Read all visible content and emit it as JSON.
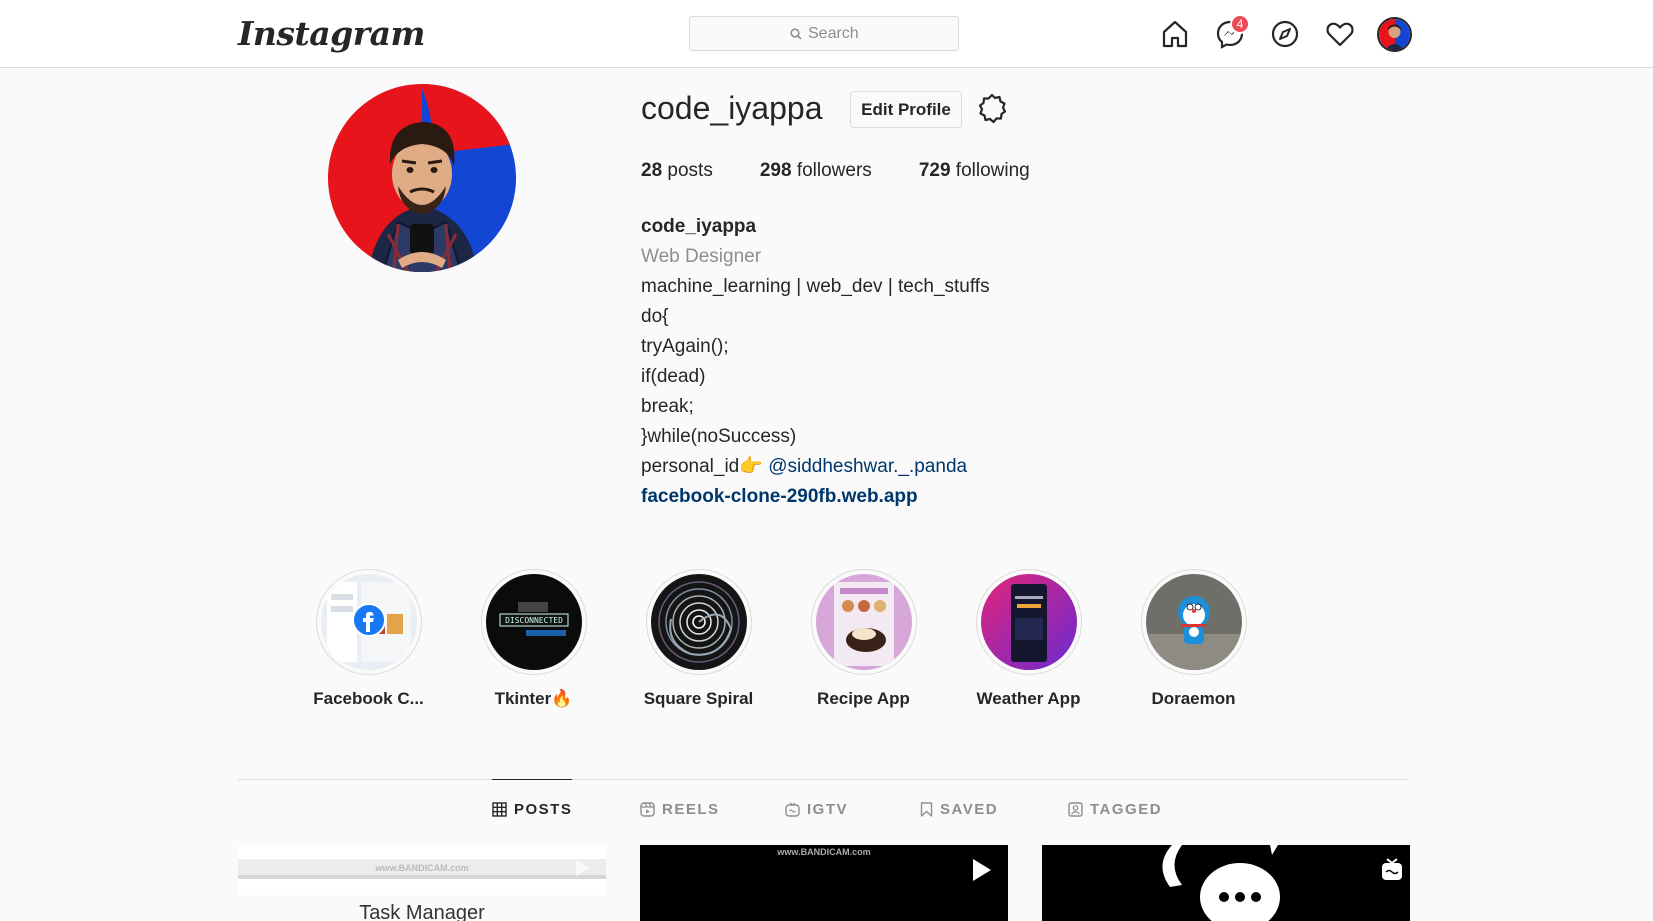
{
  "header": {
    "logo_text": "Instagram",
    "search_placeholder": "Search",
    "messages_badge": "4"
  },
  "profile": {
    "username": "code_iyappa",
    "edit_label": "Edit Profile",
    "stats": {
      "posts_count": "28",
      "posts_label": "posts",
      "followers_count": "298",
      "followers_label": "followers",
      "following_count": "729",
      "following_label": "following"
    },
    "bio": {
      "name": "code_iyappa",
      "category": "Web Designer",
      "lines": [
        "machine_learning | web_dev | tech_stuffs",
        "do{",
        "tryAgain();",
        "if(dead)",
        "break;",
        "}while(noSuccess)"
      ],
      "personal_prefix": "personal_id",
      "personal_emoji": "👉",
      "mention": "@siddheshwar._.panda",
      "website": "facebook-clone-290fb.web.app"
    }
  },
  "highlights": [
    {
      "label": "Facebook C..."
    },
    {
      "label": "Tkinter🔥"
    },
    {
      "label": "Square Spiral"
    },
    {
      "label": "Recipe App"
    },
    {
      "label": "Weather App"
    },
    {
      "label": "Doraemon"
    }
  ],
  "highlight_texts": {
    "disconnected": "DISCONNECTED",
    "watermark": "www.BANDICAM.com",
    "task_manager": "Task Manager"
  },
  "tabs": [
    {
      "label": "POSTS",
      "icon": "grid-icon",
      "active": true
    },
    {
      "label": "REELS",
      "icon": "reels-icon",
      "active": false
    },
    {
      "label": "IGTV",
      "icon": "igtv-icon",
      "active": false
    },
    {
      "label": "SAVED",
      "icon": "bookmark-icon",
      "active": false
    },
    {
      "label": "TAGGED",
      "icon": "tagged-icon",
      "active": false
    }
  ],
  "colors": {
    "badge": "#ed4956",
    "link": "#00376b",
    "border": "#dbdbdb",
    "muted": "#8e8e8e"
  }
}
